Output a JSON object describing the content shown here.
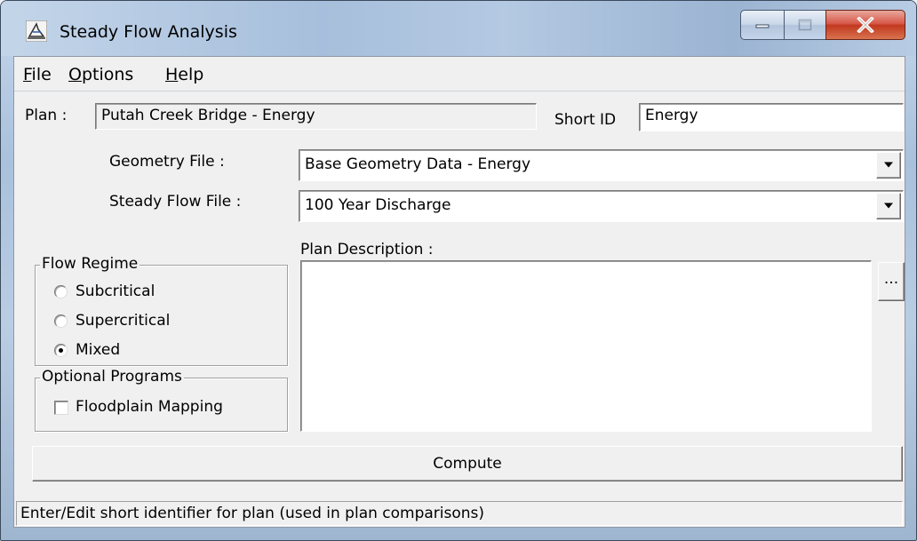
{
  "window": {
    "title": "Steady Flow Analysis"
  },
  "menu": {
    "file": {
      "accel": "F",
      "rest": "ile"
    },
    "options": {
      "accel": "O",
      "rest": "ptions"
    },
    "help": {
      "accel": "H",
      "rest": "elp"
    }
  },
  "plan": {
    "label": "Plan :",
    "value": "Putah Creek Bridge - Energy",
    "short_id_label": "Short ID",
    "short_id_value": "Energy"
  },
  "geometry": {
    "label": "Geometry File :",
    "value": "Base Geometry Data - Energy"
  },
  "steady_flow": {
    "label": "Steady Flow File :",
    "value": "100 Year Discharge"
  },
  "description": {
    "label": "Plan Description :",
    "value": "",
    "ellipsis_label": "..."
  },
  "flow_regime": {
    "title": "Flow Regime",
    "options": [
      {
        "label": "Subcritical",
        "selected": false
      },
      {
        "label": "Supercritical",
        "selected": false
      },
      {
        "label": "Mixed",
        "selected": true
      }
    ]
  },
  "optional_programs": {
    "title": "Optional Programs",
    "floodplain_mapping": {
      "label": "Floodplain Mapping",
      "checked": false
    }
  },
  "compute_label": "Compute",
  "status_text": "Enter/Edit short identifier for plan (used in plan comparisons)",
  "icons": {
    "app": "river-profile-icon",
    "minimize": "minimize-icon",
    "maximize": "maximize-icon",
    "close": "close-icon",
    "dropdown": "chevron-down-icon"
  },
  "colors": {
    "close_button": "#c1391f",
    "dialog_background": "#f0f0f0",
    "field_background": "#ffffff"
  }
}
